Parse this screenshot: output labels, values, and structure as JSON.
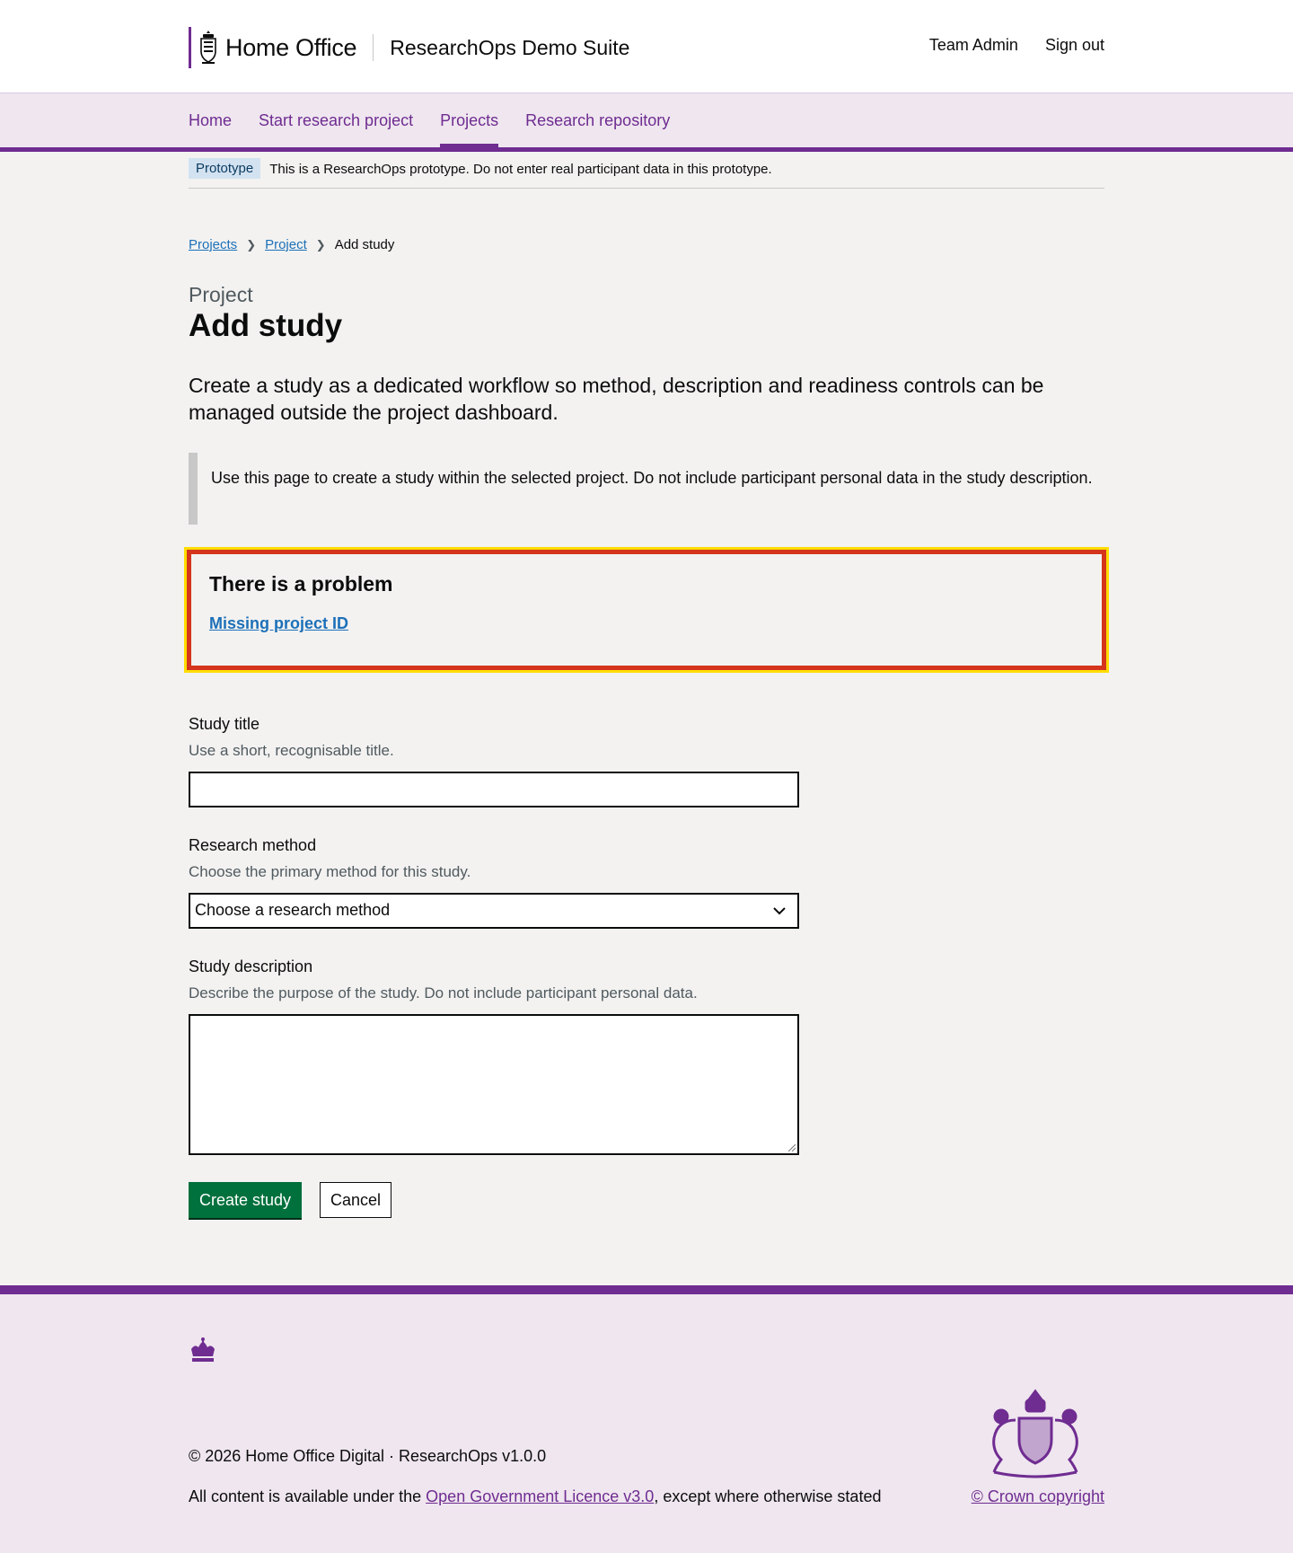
{
  "header": {
    "org_name": "Home Office",
    "service_name": "ResearchOps Demo Suite",
    "links": [
      "Team Admin",
      "Sign out"
    ]
  },
  "nav": {
    "items": [
      "Home",
      "Start research project",
      "Projects",
      "Research repository"
    ],
    "active": "Projects"
  },
  "phase_banner": {
    "tag": "Prototype",
    "text": "This is a ResearchOps prototype. Do not enter real participant data in this prototype."
  },
  "breadcrumbs": [
    "Projects",
    "Project",
    "Add study"
  ],
  "page": {
    "caption": "Project",
    "title": "Add study",
    "lead": "Create a study as a dedicated workflow so method, description and readiness controls can be managed outside the project dashboard.",
    "inset": "Use this page to create a study within the selected project. Do not include participant personal data in the study description."
  },
  "error_summary": {
    "title": "There is a problem",
    "errors": [
      "Missing project ID"
    ]
  },
  "form": {
    "study_title": {
      "label": "Study title",
      "hint": "Use a short, recognisable title.",
      "value": ""
    },
    "research_method": {
      "label": "Research method",
      "hint": "Choose the primary method for this study.",
      "selected": "Choose a research method"
    },
    "study_description": {
      "label": "Study description",
      "hint": "Describe the purpose of the study. Do not include participant personal data.",
      "value": ""
    },
    "submit_label": "Create study",
    "cancel_label": "Cancel"
  },
  "footer": {
    "copyright": "© 2026 Home Office Digital · ResearchOps v1.0.0",
    "licence_prefix": "All content is available under the ",
    "licence_link": "Open Government Licence v3.0",
    "licence_suffix": ", except where otherwise stated",
    "crown_copyright": "© Crown copyright"
  },
  "colors": {
    "brand_purple": "#6f2c91",
    "link_blue": "#1d70b8",
    "error_red": "#d4351c",
    "focus_yellow": "#ffdd00",
    "button_green": "#00703c"
  }
}
